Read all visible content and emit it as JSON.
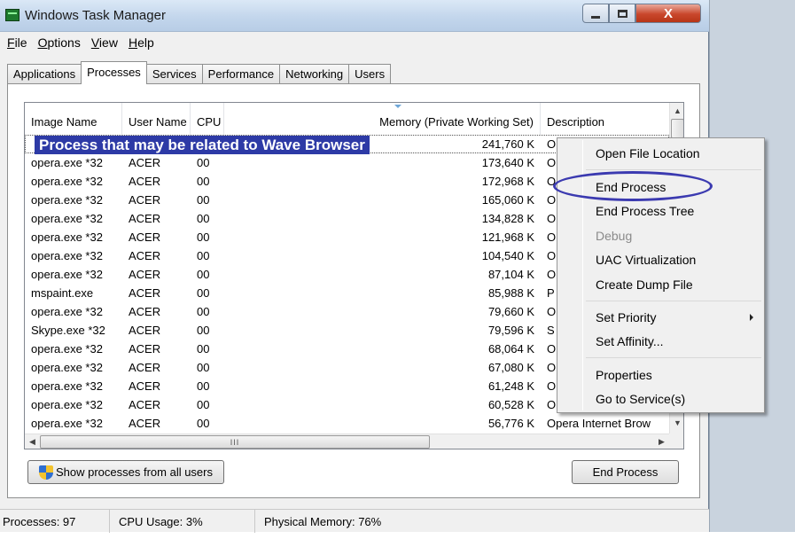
{
  "window": {
    "title": "Windows Task Manager",
    "close_glyph": "X"
  },
  "menu": {
    "items": [
      {
        "key": "F",
        "rest": "ile"
      },
      {
        "key": "O",
        "rest": "ptions"
      },
      {
        "key": "V",
        "rest": "iew"
      },
      {
        "key": "H",
        "rest": "elp"
      }
    ]
  },
  "tabs": [
    "Applications",
    "Processes",
    "Services",
    "Performance",
    "Networking",
    "Users"
  ],
  "active_tab": "Processes",
  "columns": {
    "image_name": "Image Name",
    "user_name": "User Name",
    "cpu": "CPU",
    "memory": "Memory (Private Working Set)",
    "description": "Description"
  },
  "annotation_text": "Process that may be related to Wave Browser",
  "rows": [
    {
      "image": "",
      "user": "",
      "cpu": "",
      "memory": "241,760 K",
      "desc": "O"
    },
    {
      "image": "opera.exe *32",
      "user": "ACER",
      "cpu": "00",
      "memory": "173,640 K",
      "desc": "O"
    },
    {
      "image": "opera.exe *32",
      "user": "ACER",
      "cpu": "00",
      "memory": "172,968 K",
      "desc": "O"
    },
    {
      "image": "opera.exe *32",
      "user": "ACER",
      "cpu": "00",
      "memory": "165,060 K",
      "desc": "O"
    },
    {
      "image": "opera.exe *32",
      "user": "ACER",
      "cpu": "00",
      "memory": "134,828 K",
      "desc": "O"
    },
    {
      "image": "opera.exe *32",
      "user": "ACER",
      "cpu": "00",
      "memory": "121,968 K",
      "desc": "O"
    },
    {
      "image": "opera.exe *32",
      "user": "ACER",
      "cpu": "00",
      "memory": "104,540 K",
      "desc": "O"
    },
    {
      "image": "opera.exe *32",
      "user": "ACER",
      "cpu": "00",
      "memory": "87,104 K",
      "desc": "O"
    },
    {
      "image": "mspaint.exe",
      "user": "ACER",
      "cpu": "00",
      "memory": "85,988 K",
      "desc": "P"
    },
    {
      "image": "opera.exe *32",
      "user": "ACER",
      "cpu": "00",
      "memory": "79,660 K",
      "desc": "O"
    },
    {
      "image": "Skype.exe *32",
      "user": "ACER",
      "cpu": "00",
      "memory": "79,596 K",
      "desc": "S"
    },
    {
      "image": "opera.exe *32",
      "user": "ACER",
      "cpu": "00",
      "memory": "68,064 K",
      "desc": "O"
    },
    {
      "image": "opera.exe *32",
      "user": "ACER",
      "cpu": "00",
      "memory": "67,080 K",
      "desc": "O"
    },
    {
      "image": "opera.exe *32",
      "user": "ACER",
      "cpu": "00",
      "memory": "61,248 K",
      "desc": "O"
    },
    {
      "image": "opera.exe *32",
      "user": "ACER",
      "cpu": "00",
      "memory": "60,528 K",
      "desc": "O"
    },
    {
      "image": "opera.exe *32",
      "user": "ACER",
      "cpu": "00",
      "memory": "56,776 K",
      "desc": "Opera Internet Brow"
    }
  ],
  "scroll_glyphs": {
    "up": "▲",
    "down": "▼",
    "left": "◀",
    "right": "▶",
    "grip": "III"
  },
  "buttons": {
    "show_all": "Show processes from all users",
    "end_process": "End Process"
  },
  "status": {
    "processes": "Processes: 97",
    "cpu": "CPU Usage: 3%",
    "memory": "Physical Memory: 76%"
  },
  "context_menu": {
    "open_location": "Open File Location",
    "end_process": "End Process",
    "end_tree": "End Process Tree",
    "debug": "Debug",
    "uac": "UAC Virtualization",
    "dump": "Create Dump File",
    "priority": "Set Priority",
    "affinity": "Set Affinity...",
    "properties": "Properties",
    "services": "Go to Service(s)"
  },
  "colors": {
    "annotation_banner": "#2d3aa6",
    "annotation_ellipse": "#3b3ab0",
    "close_button": "#c9472c"
  }
}
